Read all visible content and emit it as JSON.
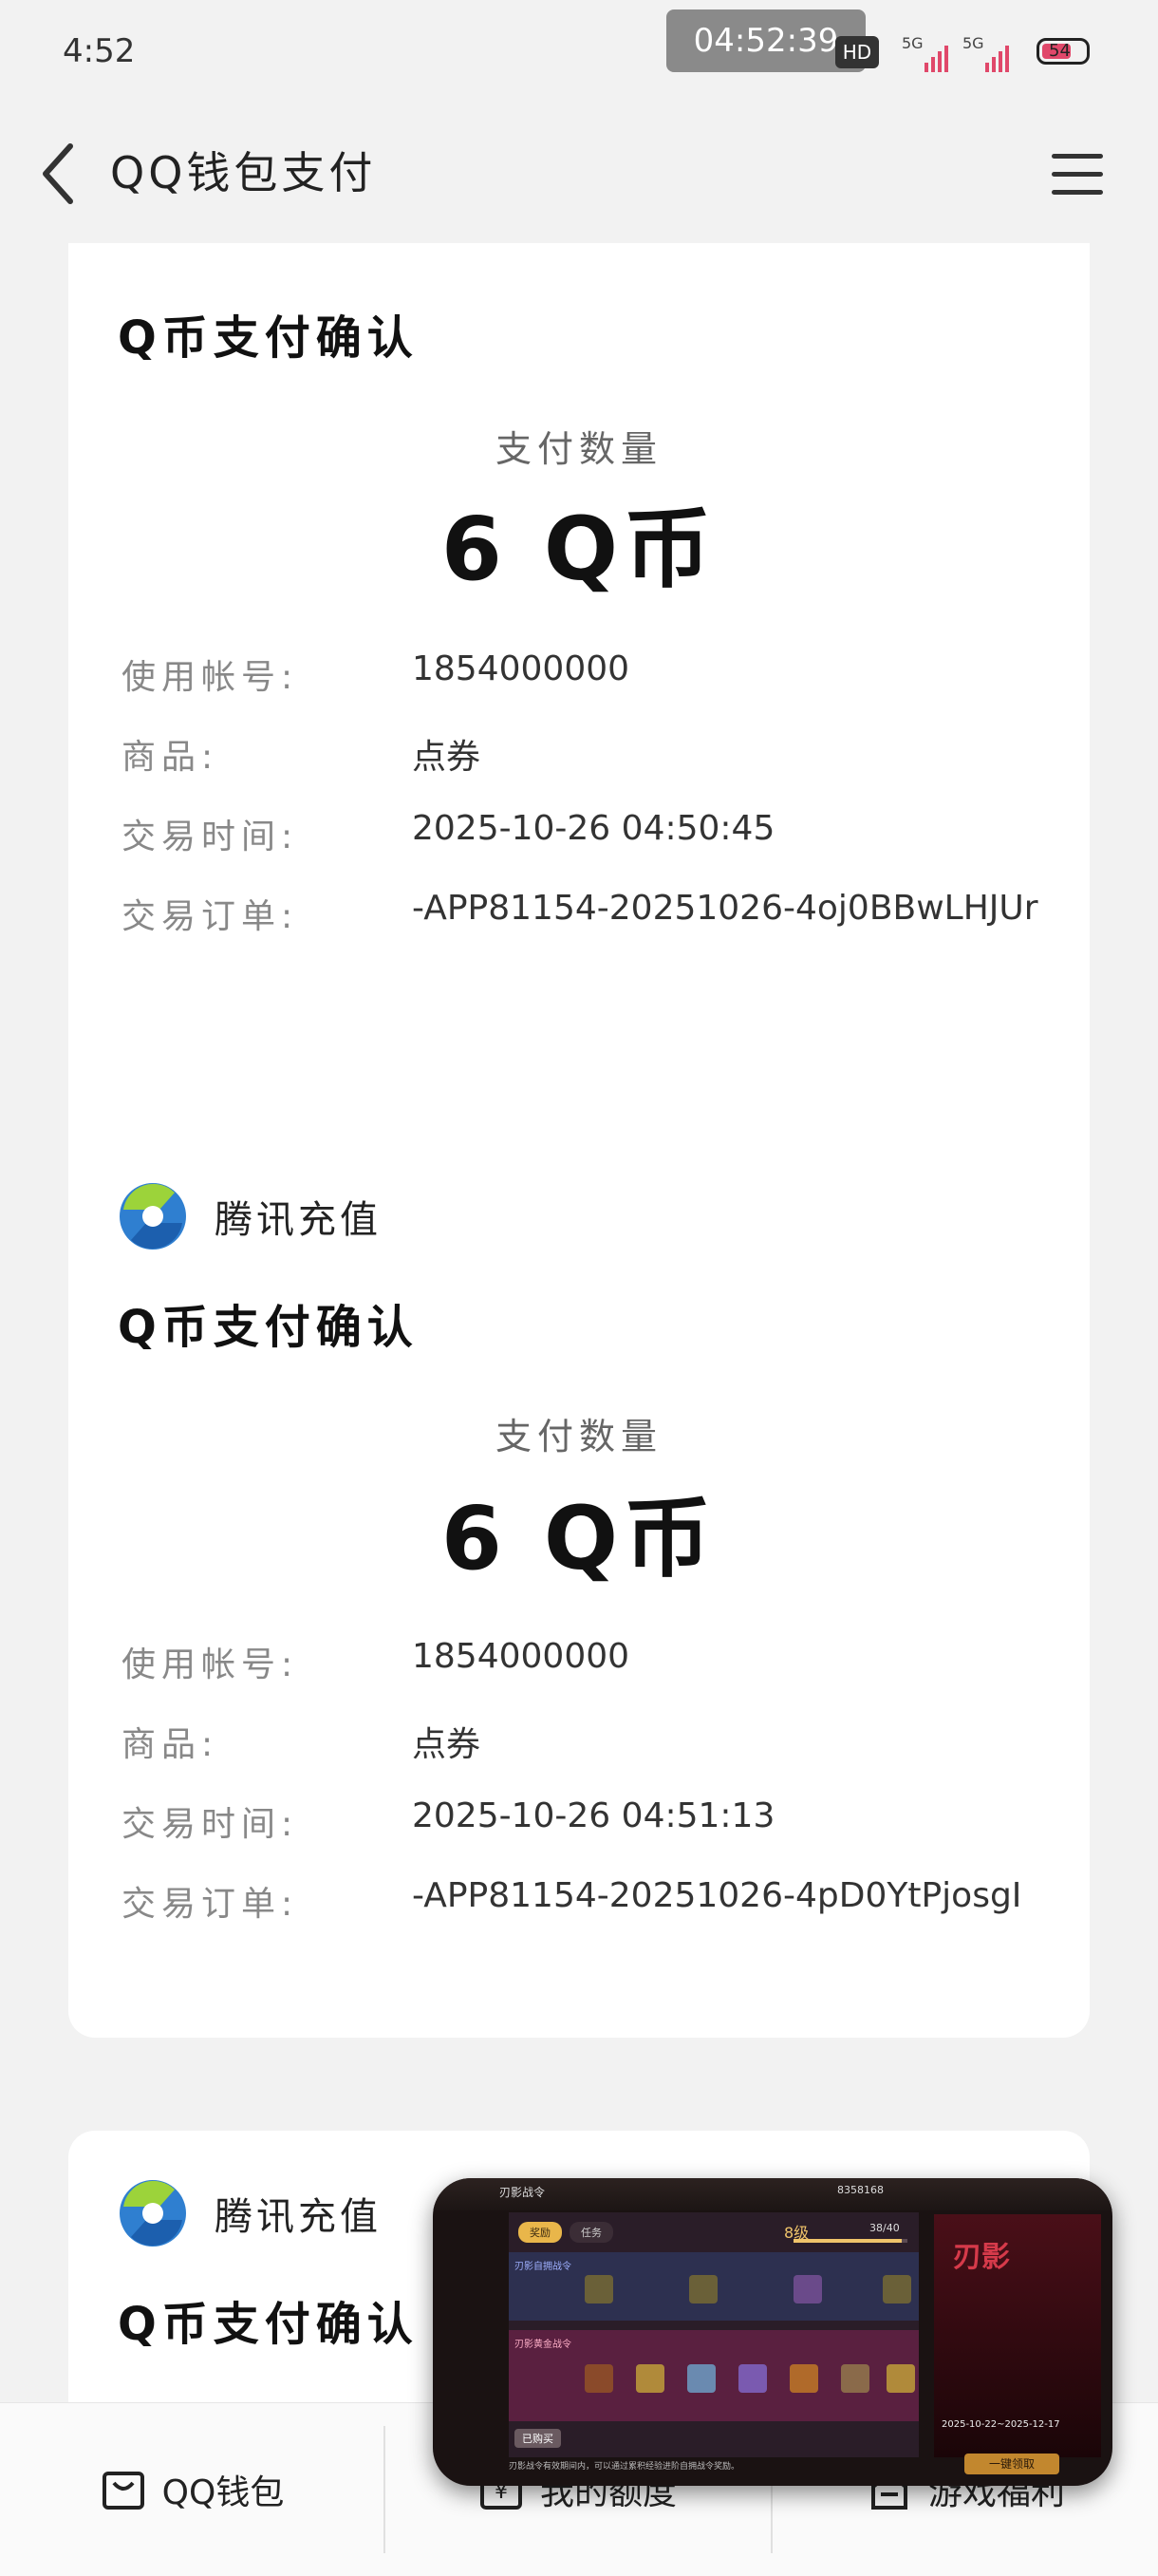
{
  "status_bar": {
    "time": "4:52",
    "recording_time": "04:52:39",
    "hd_badge": "HD",
    "sim1_label": "5G",
    "sim2_label": "5G",
    "battery": "54"
  },
  "header": {
    "title": "QQ钱包支付"
  },
  "cards": [
    {
      "title": "Q币支付确认",
      "amount_label": "支付数量",
      "amount": "6 Q币",
      "rows": [
        {
          "key": "使用帐号:",
          "value": "1854000000"
        },
        {
          "key": "商品:",
          "value": "点券"
        },
        {
          "key": "交易时间:",
          "value": "2025-10-26 04:50:45"
        },
        {
          "key": "交易订单:",
          "value": "-APP81154-20251026-4oj0BBwLHJUr"
        }
      ]
    },
    {
      "merchant": "腾讯充值",
      "title": "Q币支付确认",
      "amount_label": "支付数量",
      "amount": "6 Q币",
      "rows": [
        {
          "key": "使用帐号:",
          "value": "1854000000"
        },
        {
          "key": "商品:",
          "value": "点券"
        },
        {
          "key": "交易时间:",
          "value": "2025-10-26 04:51:13"
        },
        {
          "key": "交易订单:",
          "value": "-APP81154-20251026-4pD0YtPjosgI"
        }
      ]
    },
    {
      "merchant": "腾讯充值",
      "title": "Q币支付确认"
    }
  ],
  "bottom_nav": {
    "items": [
      {
        "label": "QQ钱包",
        "icon": "wallet-icon"
      },
      {
        "label": "我的额度",
        "icon": "yen-icon"
      },
      {
        "label": "游戏福利",
        "icon": "gift-icon"
      }
    ]
  },
  "game_overlay": {
    "top_title": "刃影战令",
    "top_counter": "8358168",
    "tab_rewards": "奖励",
    "tab_tasks": "任务",
    "level": "8级",
    "progress": "38/40",
    "progress_fraction": 0.95,
    "row1_label": "刃影自拥战令",
    "row2_label": "刃影黄金战令",
    "owned_label": "已购买",
    "poster_title": "刃影",
    "poster_date": "2025-10-22~2025-12-17",
    "claim_label": "一键领取",
    "footer_text": "刃影战令有效期间内，可以通过累积经验进阶自拥战令奖励。"
  }
}
